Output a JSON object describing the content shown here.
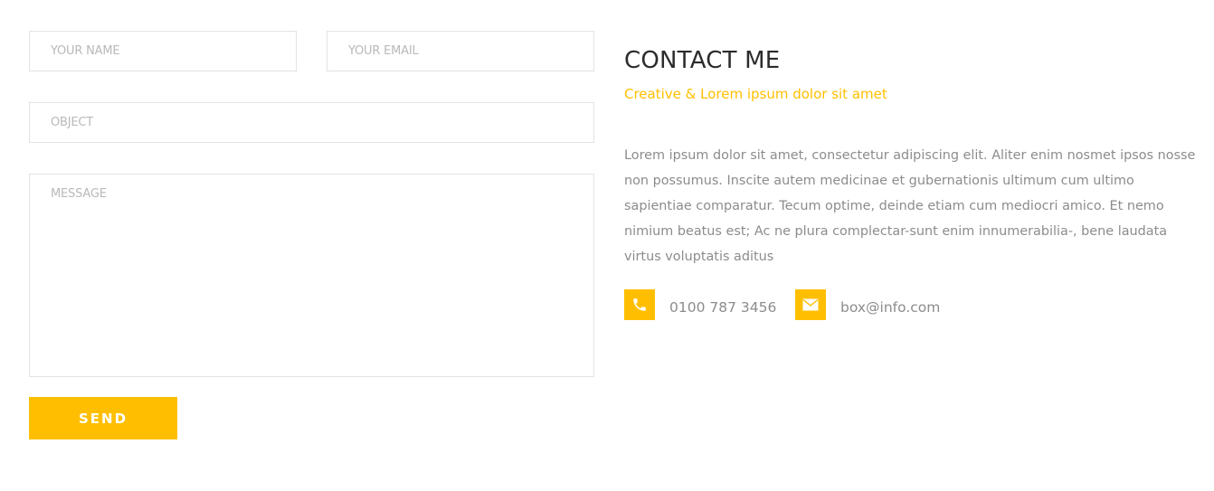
{
  "form": {
    "name_placeholder": "YOUR NAME",
    "email_placeholder": "YOUR EMAIL",
    "object_placeholder": "OBJECT",
    "message_placeholder": "MESSAGE",
    "name_value": "",
    "email_value": "",
    "object_value": "",
    "message_value": "",
    "send_label": "SEND"
  },
  "contact": {
    "title": "CONTACT ME",
    "subtitle": "Creative & Lorem ipsum dolor sit amet",
    "description": "Lorem ipsum dolor sit amet, consectetur adipiscing elit. Aliter enim nosmet ipsos nosse non possumus. Inscite autem medicinae et gubernationis ultimum cum ultimo sapientiae comparatur. Tecum optime, deinde etiam cum mediocri amico. Et nemo nimium beatus est; Ac ne plura complectar-sunt enim innumerabilia-, bene laudata virtus voluptatis aditus",
    "phone": "0100 787 3456",
    "email": "box@info.com",
    "phone_icon": "phone-icon",
    "email_icon": "envelope-icon"
  },
  "colors": {
    "accent": "#ffbf00",
    "heading": "#2c2c2c",
    "body_text": "#8c8c8c",
    "field_border": "#e3e3e3",
    "placeholder": "#b9b9b9"
  }
}
